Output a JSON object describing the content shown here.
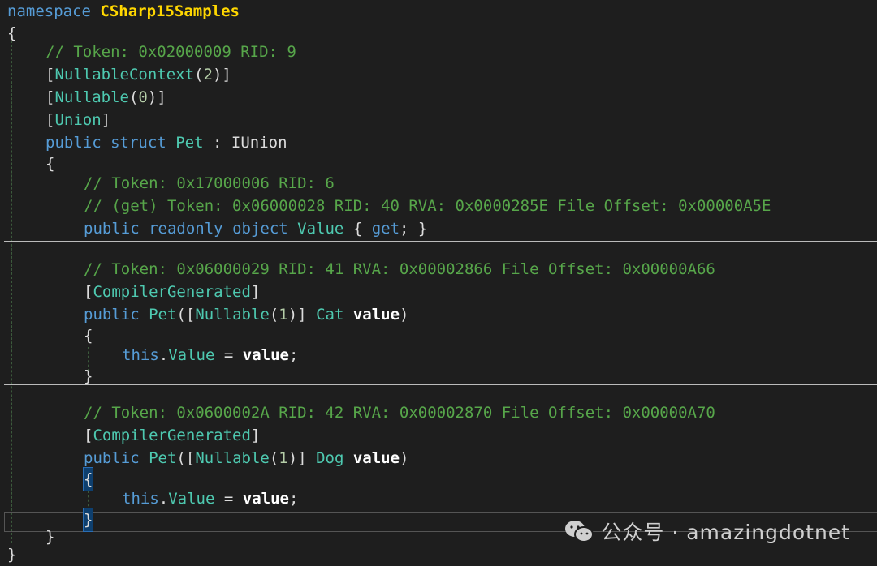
{
  "code": {
    "ns_keyword": "namespace",
    "ns_name": "CSharp15Samples",
    "open_brace": "{",
    "close_brace": "}",
    "comment_token_type": "// Token: 0x02000009 RID: 9",
    "attr_nullable_context": "NullableContext",
    "attr_nullable_context_arg": "2",
    "attr_nullable": "Nullable",
    "attr_nullable_arg": "0",
    "attr_union": "Union",
    "kw_public": "public",
    "kw_struct": "struct",
    "struct_name": "Pet",
    "base_interface": "IUnion",
    "comment_token_prop": "// Token: 0x17000006 RID: 6",
    "comment_token_getter": "// (get) Token: 0x06000028 RID: 40 RVA: 0x0000285E File Offset: 0x00000A5E",
    "kw_readonly": "readonly",
    "kw_object": "object",
    "prop_name": "Value",
    "kw_get": "get",
    "comment_ctor1": "// Token: 0x06000029 RID: 41 RVA: 0x00002866 File Offset: 0x00000A66",
    "attr_compiler_generated": "CompilerGenerated",
    "ctor_param_attr_arg": "1",
    "param_type_cat": "Cat",
    "param_name": "value",
    "kw_this": "this",
    "comment_ctor2": "// Token: 0x0600002A RID: 42 RVA: 0x00002870 File Offset: 0x00000A70",
    "param_type_dog": "Dog"
  },
  "watermark": {
    "text": "公众号 · amazingdotnet",
    "icon": "wechat-icon"
  },
  "colors": {
    "background": "#1e1e1e",
    "keyword": "#569cd6",
    "type": "#4ec9b0",
    "comment": "#57a64a",
    "number": "#b5cea8"
  }
}
